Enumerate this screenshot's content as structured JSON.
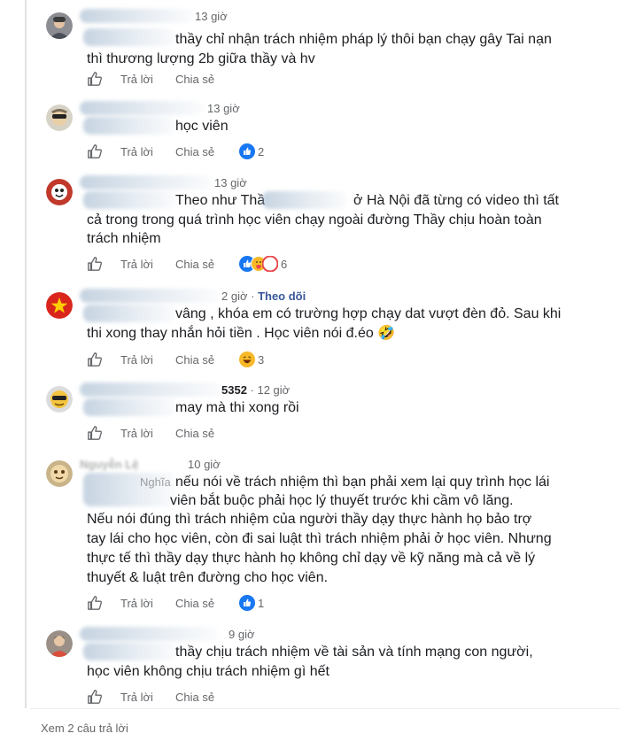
{
  "actions": {
    "reply": "Trả lời",
    "share": "Chia sẻ"
  },
  "comments": [
    {
      "time": "13 giờ",
      "lines": [
        "thầy chỉ nhận trách nhiệm pháp lý thôi bạn chạy gây Tai nạn",
        "thì thương lượng 2b giữa thầy và hv"
      ],
      "reaction_count": ""
    },
    {
      "time": "13 giờ",
      "lines": [
        "học viên"
      ],
      "reaction_count": "2"
    },
    {
      "time": "13 giờ",
      "first_line_a": "Theo như Thầ",
      "first_line_b": "ở Hà Nội đã từng có video thì tất",
      "lines": [
        "cả trong trong quá trình học viên chạy ngoài đường Thầy chịu hoàn toàn",
        "trách nhiệm"
      ],
      "reaction_count": "6"
    },
    {
      "time": "2 giờ",
      "follow": "Theo dõi",
      "lines": [
        "vâng , khóa em có trường hợp chạy dat vượt đèn đỏ. Sau khi",
        "thi xong thay nhắn hỏi tiền . Học viên nói đ.éo 🤣"
      ],
      "reaction_count": "3"
    },
    {
      "name_tail": "5352",
      "time": "12 giờ",
      "lines": [
        "may mà thi xong rồi"
      ],
      "reaction_count": ""
    },
    {
      "time": "10 giờ",
      "name_partial": "Nguyễn Lệ",
      "name_tail": "Nghĩa",
      "first_line": "nếu nói về trách nhiệm thì bạn phải xem lại quy trình học lái",
      "second_line": "viên bắt buộc phải học lý thuyết trước khi cầm vô lăng.",
      "lines": [
        "Nếu nói đúng thì trách nhiệm của người thầy dạy thực hành họ bảo trợ",
        "tay lái cho học viên, còn đi sai luật thì trách nhiệm phải ở học viên. Nhưng",
        "thực tế thì thầy dạy thực hành họ không chỉ dạy về kỹ năng mà cả về lý",
        "thuyết & luật trên đường cho học viên."
      ],
      "reaction_count": "1"
    },
    {
      "time": "9 giờ",
      "lines": [
        "thầy chịu trách nhiệm về tài sản và tính mạng con người,",
        "học viên không chịu trách nhiệm gì hết"
      ],
      "reaction_count": ""
    }
  ],
  "more_replies": "Xem 2 câu trả lời"
}
